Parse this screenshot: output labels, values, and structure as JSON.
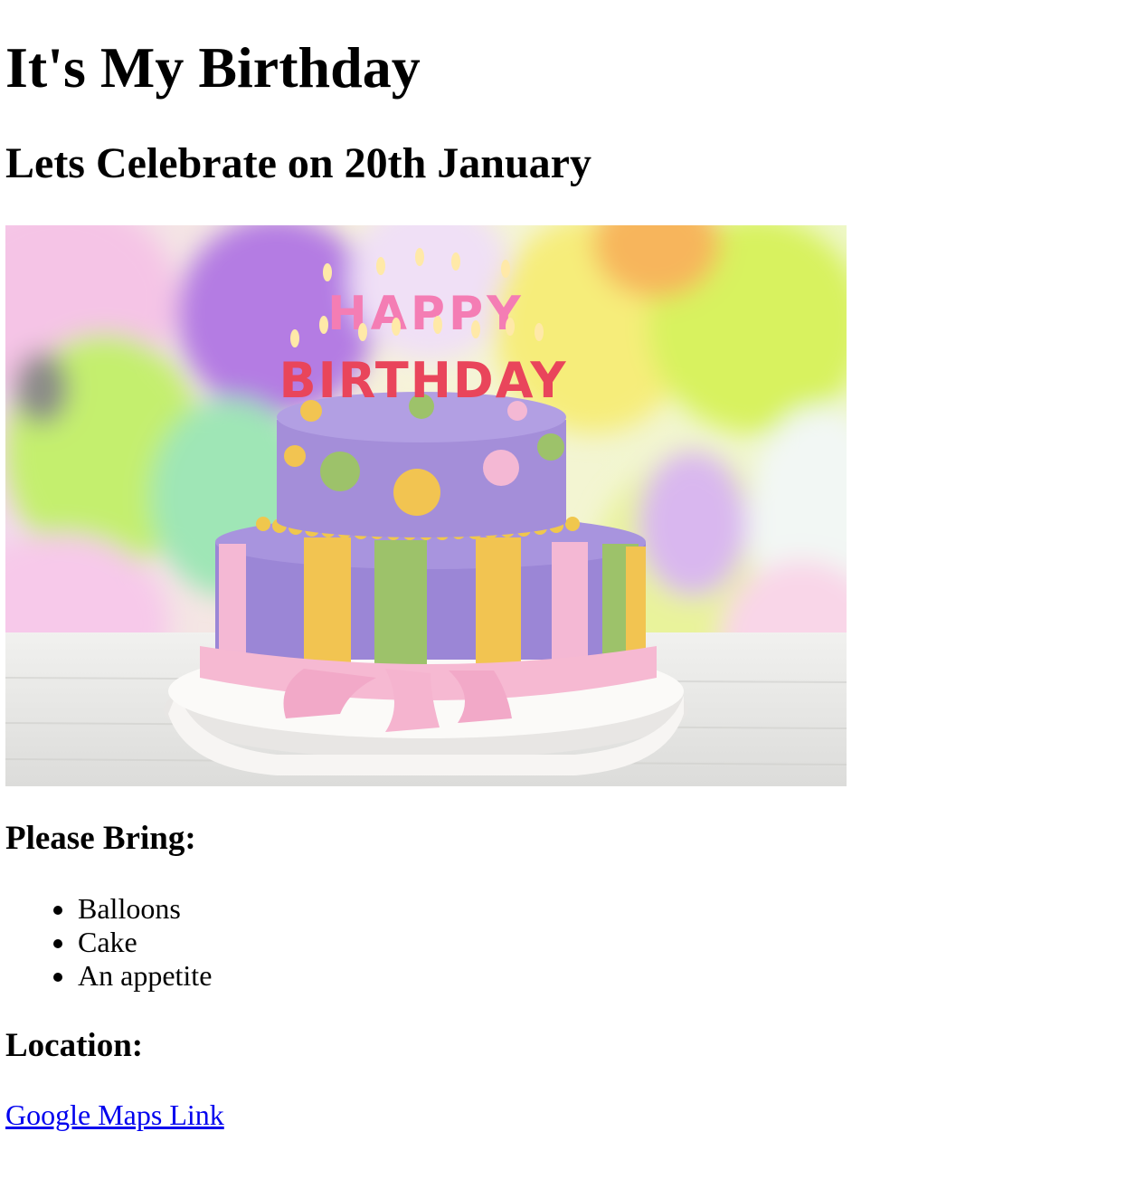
{
  "page": {
    "title": "It's My Birthday",
    "subtitle": "Lets Celebrate on 20th January"
  },
  "hero_image": {
    "description_icon": "birthday-cake-photo",
    "candle_text_line1": "HAPPY",
    "candle_text_line2": "BIRTHDAY"
  },
  "bring": {
    "heading": "Please Bring:",
    "items": [
      "Balloons",
      "Cake",
      "An appetite"
    ]
  },
  "location": {
    "heading": "Location:",
    "link_text": "Google Maps Link"
  },
  "colors": {
    "link": "#0000ee",
    "text": "#000000",
    "cake_purple": "#9b86d6",
    "cake_pink": "#f4b8d4",
    "cake_yellow": "#f2c451",
    "cake_green": "#9dc26a"
  }
}
